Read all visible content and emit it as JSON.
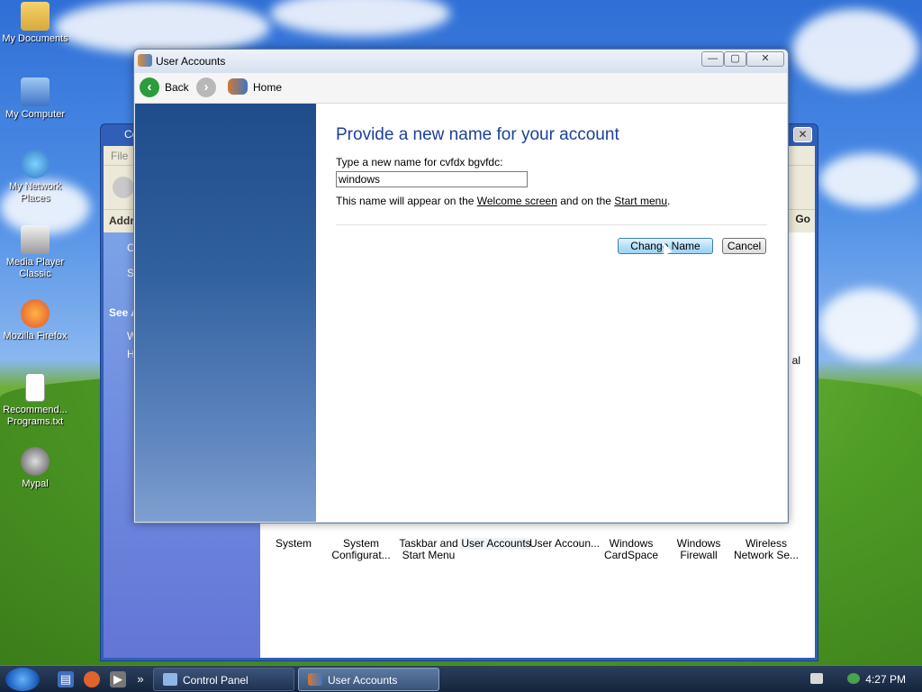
{
  "desktop": {
    "icons": [
      {
        "label": "My Documents"
      },
      {
        "label": "My Computer"
      },
      {
        "label": "My Network Places"
      },
      {
        "label": "Media Player Classic"
      },
      {
        "label": "Mozilla Firefox"
      },
      {
        "label": "Recommend... Programs.txt"
      },
      {
        "label": "Mypal"
      }
    ]
  },
  "control_panel": {
    "title": "Co",
    "menu": "File",
    "address_label": "Addre",
    "go_label": "Go",
    "sidebar": {
      "c_text": "C",
      "s_text": "S",
      "see_also": "See A",
      "w_text": "W",
      "h_text": "H"
    },
    "right_partial": "al",
    "items": [
      {
        "label": "System"
      },
      {
        "label": "System Configurat..."
      },
      {
        "label": "Taskbar and Start Menu"
      },
      {
        "label": "User Accounts"
      },
      {
        "label": "User Accoun..."
      },
      {
        "label": "Windows CardSpace"
      },
      {
        "label": "Windows Firewall"
      },
      {
        "label": "Wireless Network Se..."
      }
    ]
  },
  "user_accounts": {
    "title": "User Accounts",
    "nav": {
      "back": "Back",
      "home": "Home"
    },
    "heading": "Provide a new name for your account",
    "prompt": "Type a new name for cvfdx bgvfdc:",
    "name_value": "windows",
    "note_before": "This name will appear on the ",
    "note_link1": "Welcome screen",
    "note_middle": " and on the ",
    "note_link2": "Start menu",
    "note_after": ".",
    "change_button": "Change Name",
    "cancel_button": "Cancel"
  },
  "taskbar": {
    "tasks": [
      {
        "label": "Control Panel"
      },
      {
        "label": "User Accounts"
      }
    ],
    "clock": "4:27 PM",
    "overflow": "»"
  },
  "colors": {
    "accent": "#1e3f9a",
    "taskbar": "#14243c"
  }
}
